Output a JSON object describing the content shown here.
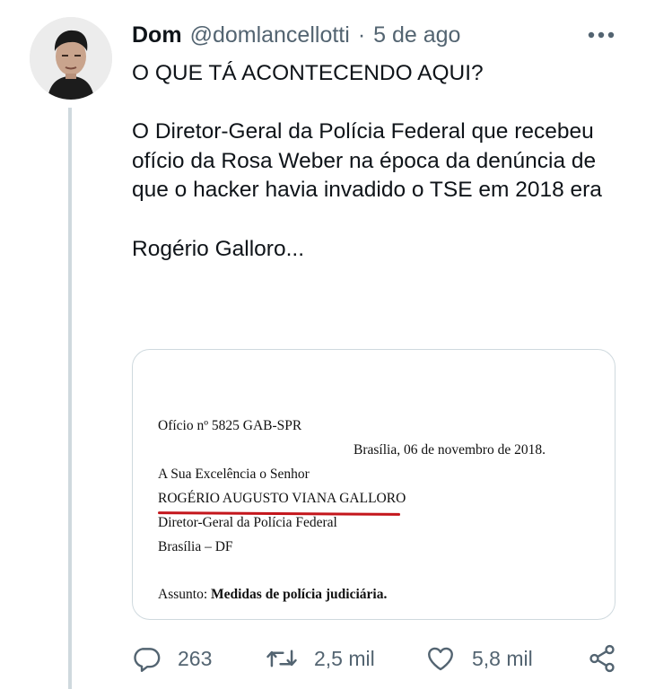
{
  "tweet": {
    "author_name": "Dom",
    "handle": "@domlancellotti",
    "separator": "·",
    "date": "5 de ago",
    "text": {
      "line1": "O QUE TÁ ACONTECENDO AQUI?",
      "para2": "O Diretor-Geral da Polícia Federal que recebeu ofício da Rosa Weber na época da denúncia de que o hacker havia invadido o TSE em 2018 era",
      "para3": "Rogério Galloro..."
    }
  },
  "document_image": {
    "oficio": "Ofício nº 5825 GAB-SPR",
    "place_date": "Brasília, 06 de novembro de 2018.",
    "salutation": "A Sua Excelência o Senhor",
    "recipient": "ROGÉRIO AUGUSTO VIANA GALLORO",
    "role": "Diretor-Geral da Polícia Federal",
    "city": "Brasília – DF",
    "subject_label": "Assunto:",
    "subject": "Medidas de polícia judiciária.",
    "highlight_color": "#c4161c"
  },
  "actions": {
    "replies": "263",
    "retweets": "2,5 mil",
    "likes": "5,8 mil",
    "icons": [
      "reply-icon",
      "retweet-icon",
      "like-icon",
      "share-icon"
    ]
  },
  "colors": {
    "text": "#0f1419",
    "secondary": "#536471",
    "border": "#cfd9de"
  }
}
